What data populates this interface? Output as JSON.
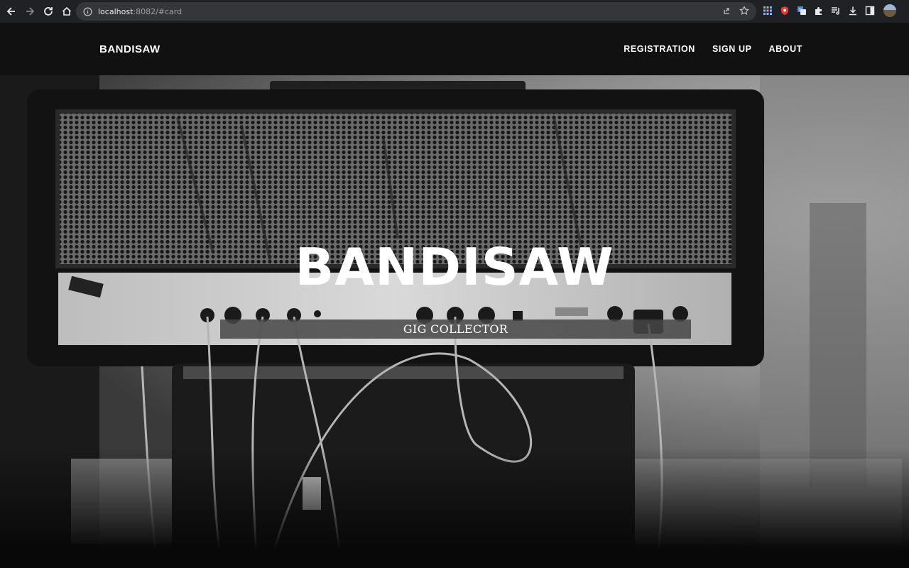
{
  "browser": {
    "url_host": "localhost",
    "url_rest": ":8082/#card"
  },
  "site": {
    "brand": "BANDISAW",
    "menu": [
      "REGISTRATION",
      "SIGN UP",
      "ABOUT"
    ]
  },
  "hero": {
    "title": "BANDISAW",
    "subtitle": "GIG COLLECTOR"
  }
}
